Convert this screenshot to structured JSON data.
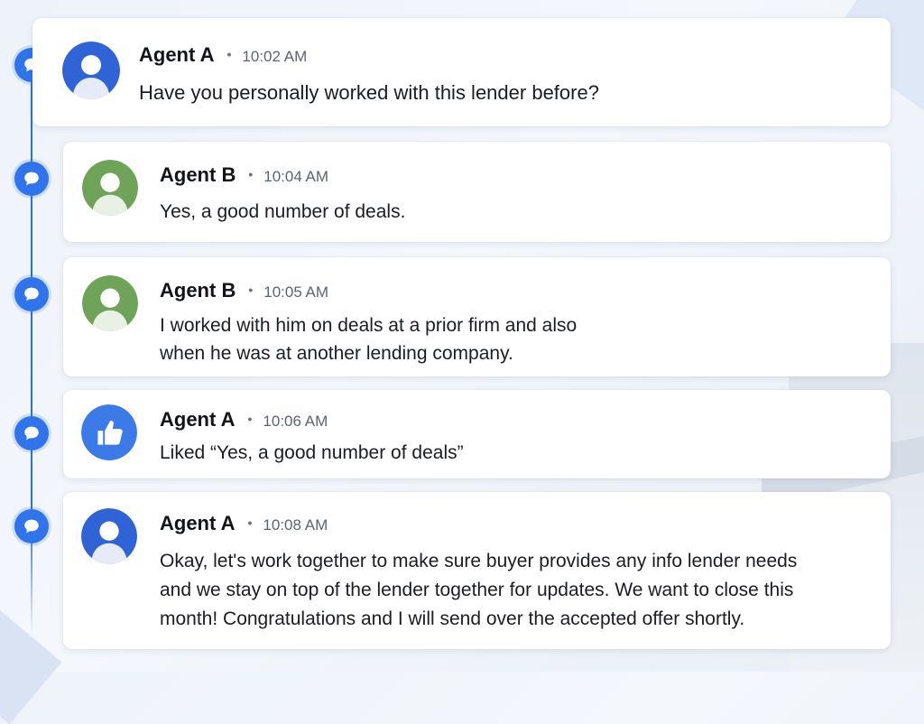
{
  "messages": [
    {
      "sender": "Agent A",
      "time": "10:02 AM",
      "text": "Have you personally worked with this lender before?",
      "avatar": "person-avatar-blue"
    },
    {
      "sender": "Agent B",
      "time": "10:04 AM",
      "text": "Yes, a good number of deals.",
      "avatar": "person-avatar-green"
    },
    {
      "sender": "Agent B",
      "time": "10:05 AM",
      "text": "I worked with him on deals at a prior firm and also\nwhen he was at another lending company.",
      "avatar": "person-avatar-green"
    },
    {
      "sender": "Agent A",
      "time": "10:06 AM",
      "text": "Liked “Yes, a good number of deals”",
      "avatar": "thumbs-up-avatar"
    },
    {
      "sender": "Agent A",
      "time": "10:08 AM",
      "text": "Okay, let's work together to make sure buyer provides any info lender needs\nand we stay on top of the lender together for updates. We want to close this\nmonth! Congratulations and I will send over the accepted offer shortly.",
      "avatar": "person-avatar-blue"
    }
  ],
  "separator": "•",
  "colors": {
    "accent": "#2f74ea",
    "avatar_blue": "#2f63d6",
    "avatar_green": "#6fa35a"
  }
}
